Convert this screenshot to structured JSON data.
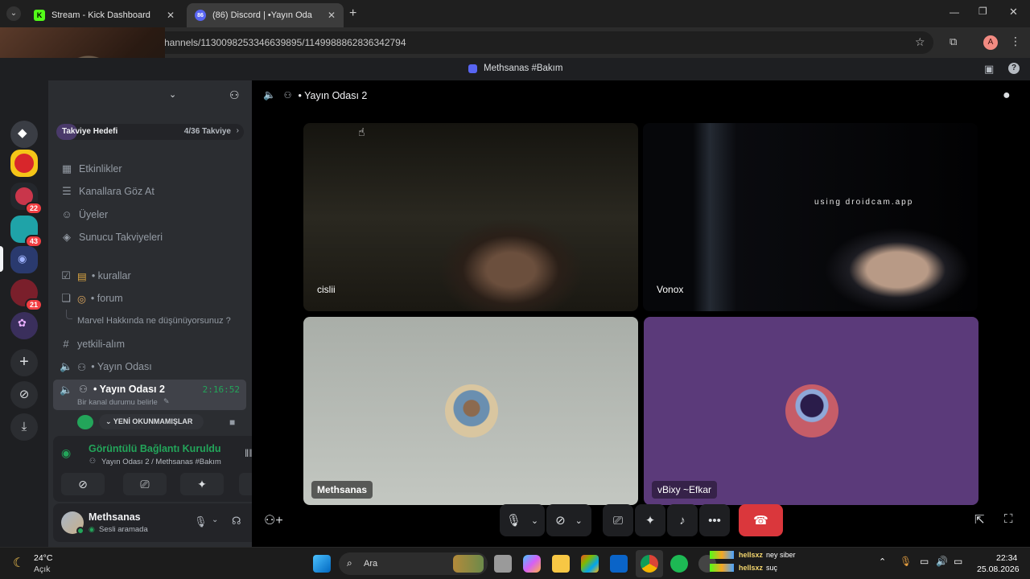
{
  "browser": {
    "tabs": [
      {
        "title": "Stream - Kick Dashboard",
        "favicon": "K"
      },
      {
        "title": "(86) Discord | •Yayın Oda",
        "favicon": "86"
      }
    ],
    "url": "hannels/1130098253346639895/1149988862836342794",
    "profile_initial": "A"
  },
  "discord": {
    "title": "Methsanas #Bakım",
    "boost": {
      "label": "Takviye Hedefi",
      "progress": "4/36 Takviye"
    },
    "nav_items": [
      {
        "label": "Etkinlikler",
        "icon": "calendar-icon",
        "glyph": "▦"
      },
      {
        "label": "Kanallara Göz At",
        "icon": "browse-channels-icon",
        "glyph": "☰"
      },
      {
        "label": "Üyeler",
        "icon": "members-icon",
        "glyph": "☺"
      },
      {
        "label": "Sunucu Takviyeleri",
        "icon": "boost-icon",
        "glyph": "◈"
      }
    ],
    "channels": {
      "kurallar": "• kurallar",
      "forum": "• forum",
      "thread": "Marvel Hakkında ne düşünüyorsunuz ?",
      "yetkili": "yetkili-alım",
      "voice1": "• Yayın Odası",
      "voice2": "• Yayın Odası 2",
      "voice2_timer": "2:16:52",
      "voice2_status": "Bir kanal durumu belirle",
      "unread_label": "YENİ OKUNMAMIŞLAR"
    },
    "servers": [
      {
        "badge": ""
      },
      {
        "badge": ""
      },
      {
        "badge": "22"
      },
      {
        "badge": "43"
      },
      {
        "badge": ""
      },
      {
        "badge": "21"
      },
      {
        "badge": ""
      }
    ],
    "voice_panel": {
      "status": "Görüntülü Bağlantı Kuruldu",
      "location": "Yayın Odası 2 / Methsanas #Bakım"
    },
    "user": {
      "name": "Methsanas",
      "status": "Sesli aramada"
    },
    "call": {
      "channel_title": "• Yayın Odası 2",
      "participants": [
        {
          "name": "cislii"
        },
        {
          "name": "Vonox",
          "overlay": "using droidcam.app"
        },
        {
          "name": "Methsanas"
        },
        {
          "name": "vBixy ~Efkar"
        }
      ]
    },
    "colors": {
      "accent": "#23a55a",
      "danger": "#da373c",
      "blurple": "#5865f2",
      "purple_tile": "#5b3a7a"
    }
  },
  "taskbar": {
    "weather": {
      "temp": "24°C",
      "condition": "Açık"
    },
    "search_placeholder": "Ara",
    "chat": [
      {
        "user": "hellsxz",
        "message": "ney siber"
      },
      {
        "user": "hellsxz",
        "message": "suç"
      }
    ],
    "time": "22:34",
    "date": "25.08.2026"
  }
}
